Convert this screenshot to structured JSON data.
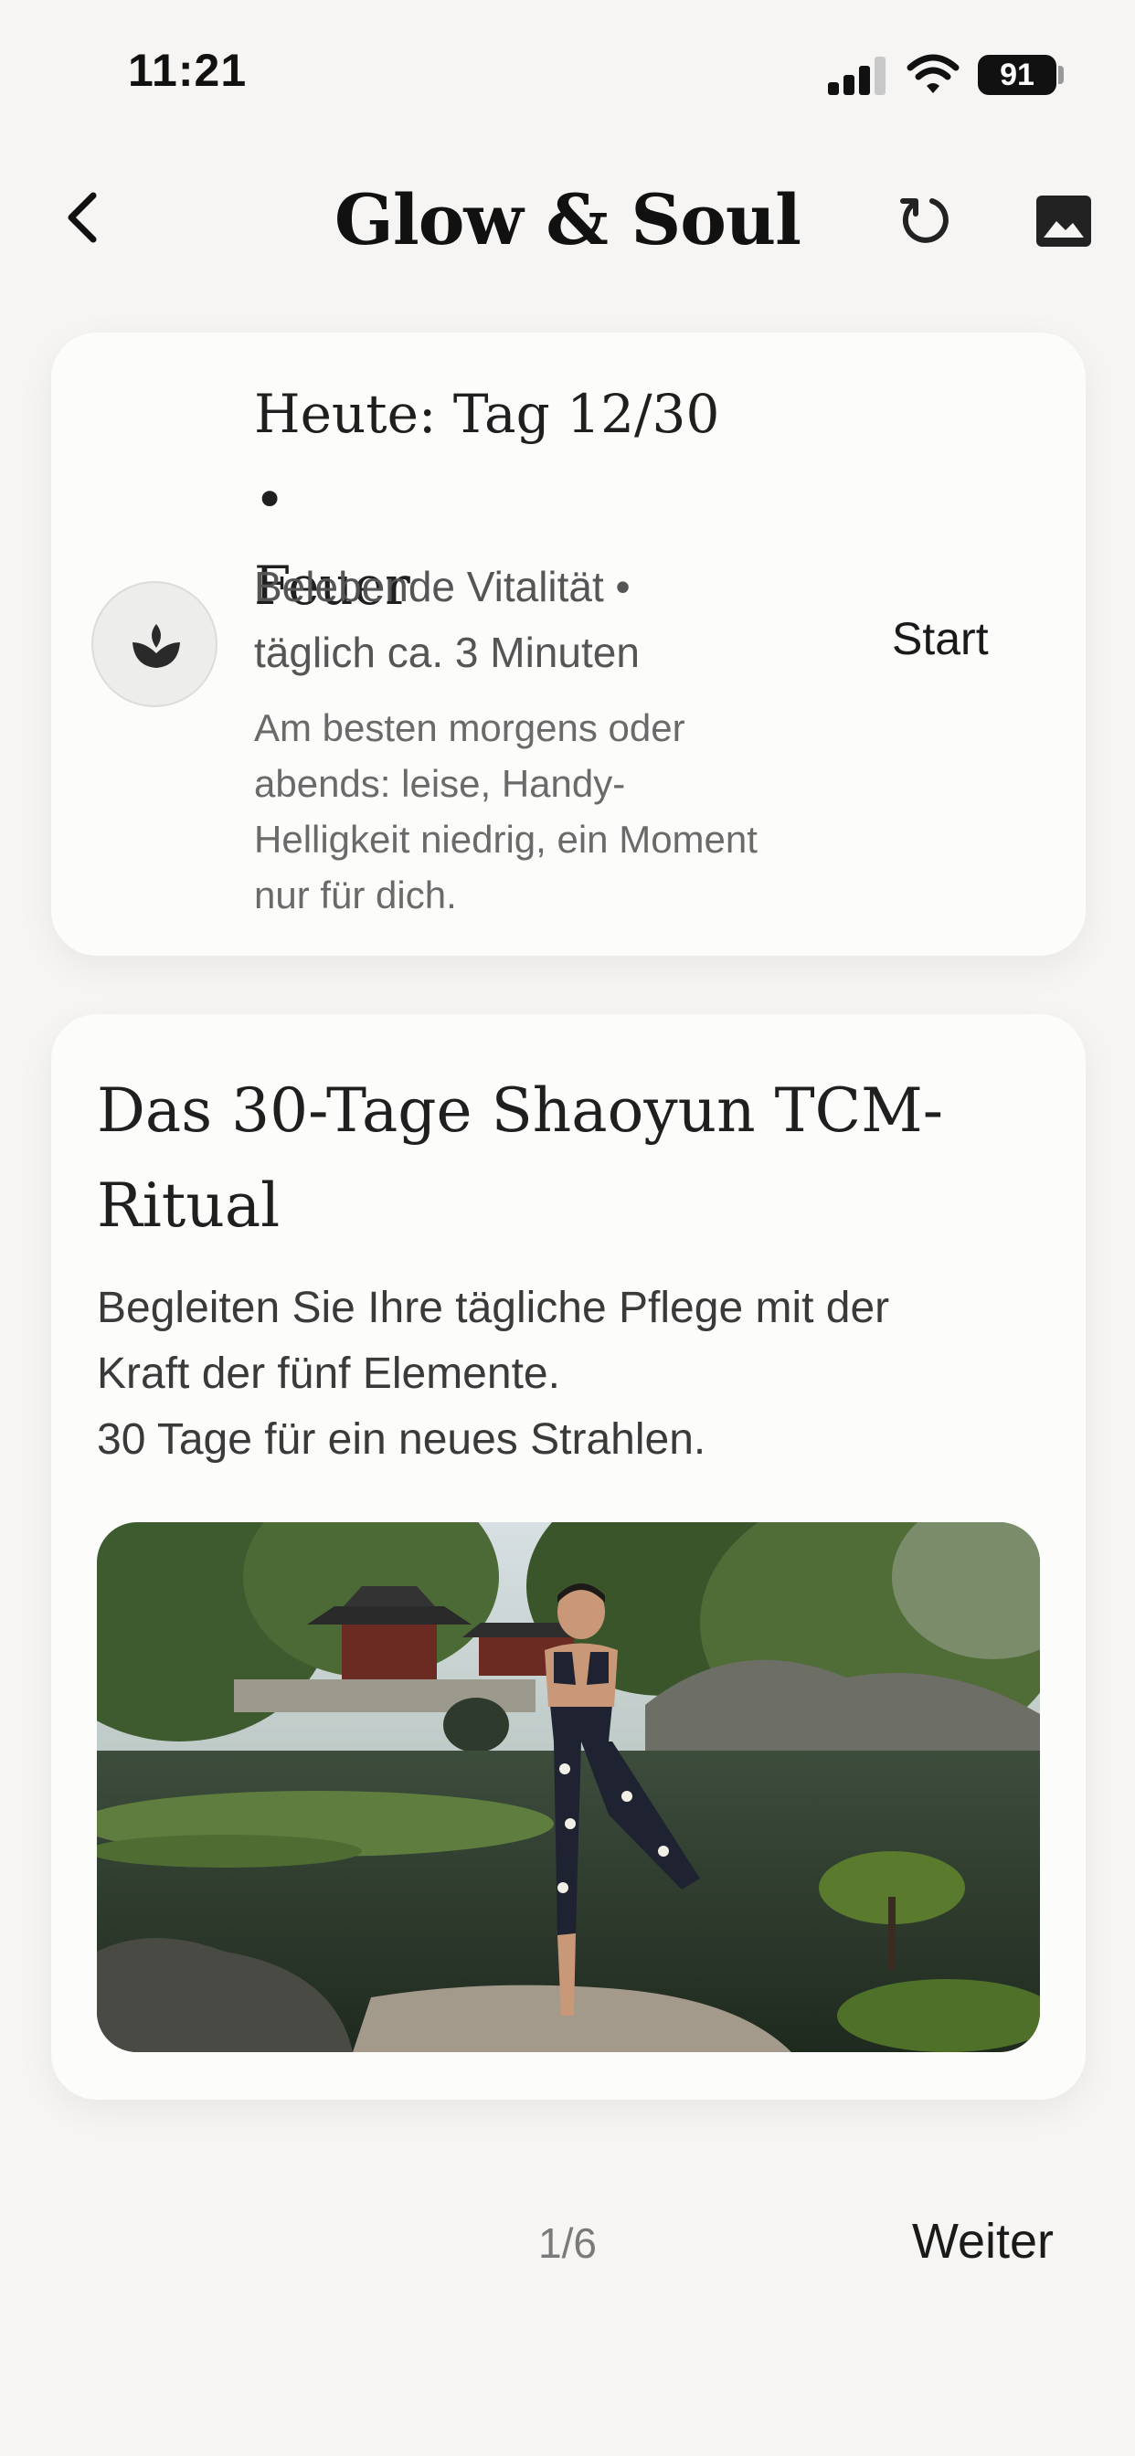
{
  "status_bar": {
    "time": "11:21",
    "battery": "91"
  },
  "header": {
    "title": "Glow & Soul",
    "back_icon": "chevron-left-icon",
    "refresh_icon": "refresh-icon",
    "image_icon": "image-icon"
  },
  "today_card": {
    "icon": "lotus-icon",
    "heading_line1": "Heute: Tag 12/30 •",
    "heading_line2": "Feuer",
    "sub_line1": "Belebende Vitalität  •",
    "sub_line2": "täglich ca. 3 Minuten",
    "note_line1": "Am besten morgens oder",
    "note_line2": "abends: leise, Handy-",
    "note_line3": "Helligkeit niedrig, ein Moment",
    "note_line4": "nur für dich.",
    "start_label": "Start"
  },
  "ritual_card": {
    "title_line1": "Das 30-Tage Shaoyun TCM-",
    "title_line2": "Ritual",
    "desc_line1": "Begleiten Sie Ihre tägliche Pflege mit der",
    "desc_line2": "Kraft der fünf Elemente.",
    "desc_line3": "30 Tage für ein neues Strahlen."
  },
  "footer": {
    "page_indicator": "1/6",
    "next_label": "Weiter"
  }
}
